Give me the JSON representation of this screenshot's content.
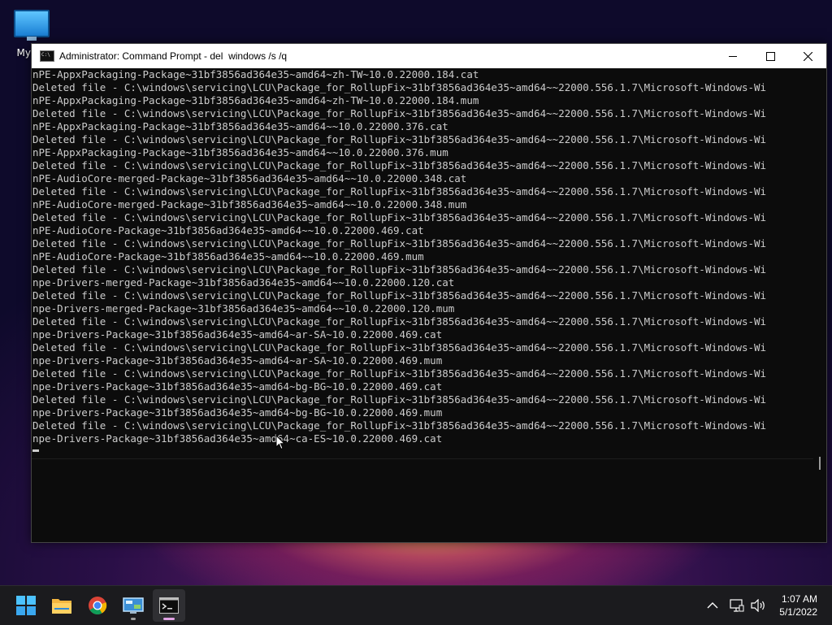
{
  "desktop": {
    "icon_label": "My Co"
  },
  "window": {
    "title": "Administrator: Command Prompt - del  windows /s /q"
  },
  "console_lines": [
    "nPE-AppxPackaging-Package~31bf3856ad364e35~amd64~zh-TW~10.0.22000.184.cat",
    "Deleted file - C:\\windows\\servicing\\LCU\\Package_for_RollupFix~31bf3856ad364e35~amd64~~22000.556.1.7\\Microsoft-Windows-Wi",
    "nPE-AppxPackaging-Package~31bf3856ad364e35~amd64~zh-TW~10.0.22000.184.mum",
    "Deleted file - C:\\windows\\servicing\\LCU\\Package_for_RollupFix~31bf3856ad364e35~amd64~~22000.556.1.7\\Microsoft-Windows-Wi",
    "nPE-AppxPackaging-Package~31bf3856ad364e35~amd64~~10.0.22000.376.cat",
    "Deleted file - C:\\windows\\servicing\\LCU\\Package_for_RollupFix~31bf3856ad364e35~amd64~~22000.556.1.7\\Microsoft-Windows-Wi",
    "nPE-AppxPackaging-Package~31bf3856ad364e35~amd64~~10.0.22000.376.mum",
    "Deleted file - C:\\windows\\servicing\\LCU\\Package_for_RollupFix~31bf3856ad364e35~amd64~~22000.556.1.7\\Microsoft-Windows-Wi",
    "nPE-AudioCore-merged-Package~31bf3856ad364e35~amd64~~10.0.22000.348.cat",
    "Deleted file - C:\\windows\\servicing\\LCU\\Package_for_RollupFix~31bf3856ad364e35~amd64~~22000.556.1.7\\Microsoft-Windows-Wi",
    "nPE-AudioCore-merged-Package~31bf3856ad364e35~amd64~~10.0.22000.348.mum",
    "Deleted file - C:\\windows\\servicing\\LCU\\Package_for_RollupFix~31bf3856ad364e35~amd64~~22000.556.1.7\\Microsoft-Windows-Wi",
    "nPE-AudioCore-Package~31bf3856ad364e35~amd64~~10.0.22000.469.cat",
    "Deleted file - C:\\windows\\servicing\\LCU\\Package_for_RollupFix~31bf3856ad364e35~amd64~~22000.556.1.7\\Microsoft-Windows-Wi",
    "nPE-AudioCore-Package~31bf3856ad364e35~amd64~~10.0.22000.469.mum",
    "Deleted file - C:\\windows\\servicing\\LCU\\Package_for_RollupFix~31bf3856ad364e35~amd64~~22000.556.1.7\\Microsoft-Windows-Wi",
    "npe-Drivers-merged-Package~31bf3856ad364e35~amd64~~10.0.22000.120.cat",
    "Deleted file - C:\\windows\\servicing\\LCU\\Package_for_RollupFix~31bf3856ad364e35~amd64~~22000.556.1.7\\Microsoft-Windows-Wi",
    "npe-Drivers-merged-Package~31bf3856ad364e35~amd64~~10.0.22000.120.mum",
    "Deleted file - C:\\windows\\servicing\\LCU\\Package_for_RollupFix~31bf3856ad364e35~amd64~~22000.556.1.7\\Microsoft-Windows-Wi",
    "npe-Drivers-Package~31bf3856ad364e35~amd64~ar-SA~10.0.22000.469.cat",
    "Deleted file - C:\\windows\\servicing\\LCU\\Package_for_RollupFix~31bf3856ad364e35~amd64~~22000.556.1.7\\Microsoft-Windows-Wi",
    "npe-Drivers-Package~31bf3856ad364e35~amd64~ar-SA~10.0.22000.469.mum",
    "Deleted file - C:\\windows\\servicing\\LCU\\Package_for_RollupFix~31bf3856ad364e35~amd64~~22000.556.1.7\\Microsoft-Windows-Wi",
    "npe-Drivers-Package~31bf3856ad364e35~amd64~bg-BG~10.0.22000.469.cat",
    "Deleted file - C:\\windows\\servicing\\LCU\\Package_for_RollupFix~31bf3856ad364e35~amd64~~22000.556.1.7\\Microsoft-Windows-Wi",
    "npe-Drivers-Package~31bf3856ad364e35~amd64~bg-BG~10.0.22000.469.mum",
    "Deleted file - C:\\windows\\servicing\\LCU\\Package_for_RollupFix~31bf3856ad364e35~amd64~~22000.556.1.7\\Microsoft-Windows-Wi",
    "npe-Drivers-Package~31bf3856ad364e35~amd64~ca-ES~10.0.22000.469.cat"
  ],
  "taskbar": {
    "items": [
      "start-icon",
      "file-explorer-icon",
      "chrome-icon",
      "control-panel-icon",
      "command-prompt-icon"
    ],
    "tray_icons": [
      "chevron-up-icon",
      "network-icon",
      "volume-icon"
    ]
  },
  "clock": {
    "time": "1:07 AM",
    "date": "5/1/2022"
  },
  "colors": {
    "console_bg": "#0c0c0c",
    "console_text": "#cccccc",
    "taskbar_bg": "#1b1b1e",
    "active_indicator": "#e0a2e3"
  }
}
